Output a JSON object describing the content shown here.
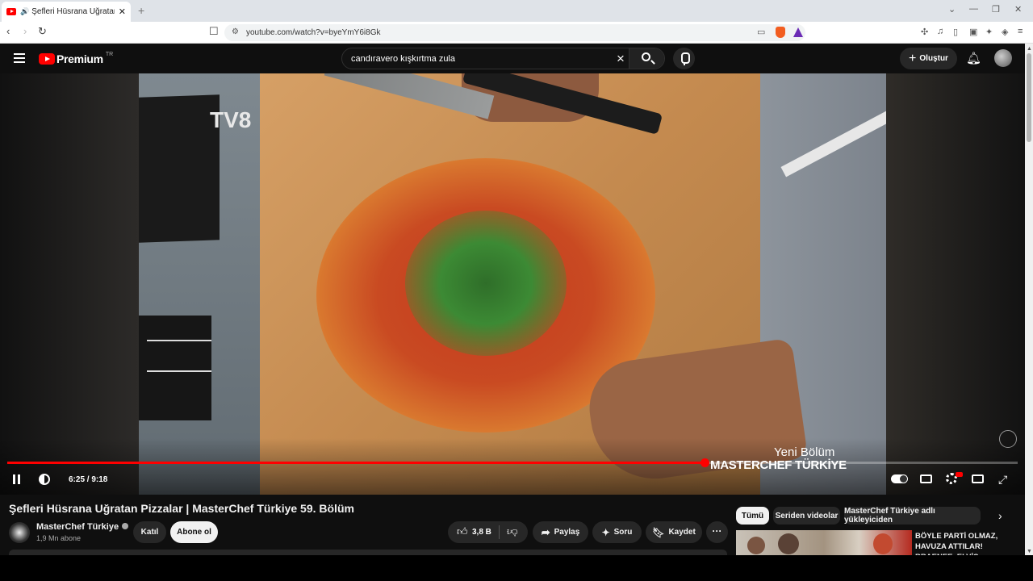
{
  "browser": {
    "tab_title": "Şefleri Hüsrana Uğratan Pizzalar",
    "url": "youtube.com/watch?v=byeYmY6i8Gk"
  },
  "header": {
    "logo_text": "Premium",
    "region": "TR",
    "search_query": "candıravero kışkırtma zula",
    "create_label": "Oluştur"
  },
  "player": {
    "time_current": "6:25",
    "time_total": "9:18",
    "time_label": "6:25 / 9:18",
    "progress_fraction": 0.69,
    "overlay_line1": "Yeni Bölüm",
    "overlay_line2": "MASTERCHEF TÜRKİYE",
    "channel_logo": "TV8"
  },
  "video": {
    "title": "Şefleri Hüsrana Uğratan Pizzalar | MasterChef Türkiye 59. Bölüm",
    "channel_name": "MasterChef Türkiye",
    "subscribers": "1,9 Mn abone",
    "join_label": "Katıl",
    "subscribe_label": "Abone ol",
    "like_count": "3,8 B",
    "share_label": "Paylaş",
    "ask_label": "Soru",
    "save_label": "Kaydet"
  },
  "sidebar": {
    "chips": [
      {
        "label": "Tümü",
        "active": true
      },
      {
        "label": "Seriden videolar",
        "active": false
      },
      {
        "label": "MasterChef Türkiye adlı yükleyiciden",
        "active": false
      }
    ],
    "first_video_title": "BÖYLE PARTİ OLMAZ, HAVUZA ATTILAR! RRAENEE, ELVİS KARAOĞLAN, EDA"
  },
  "colors": {
    "accent": "#ff0000",
    "background": "#0f0f0f"
  }
}
